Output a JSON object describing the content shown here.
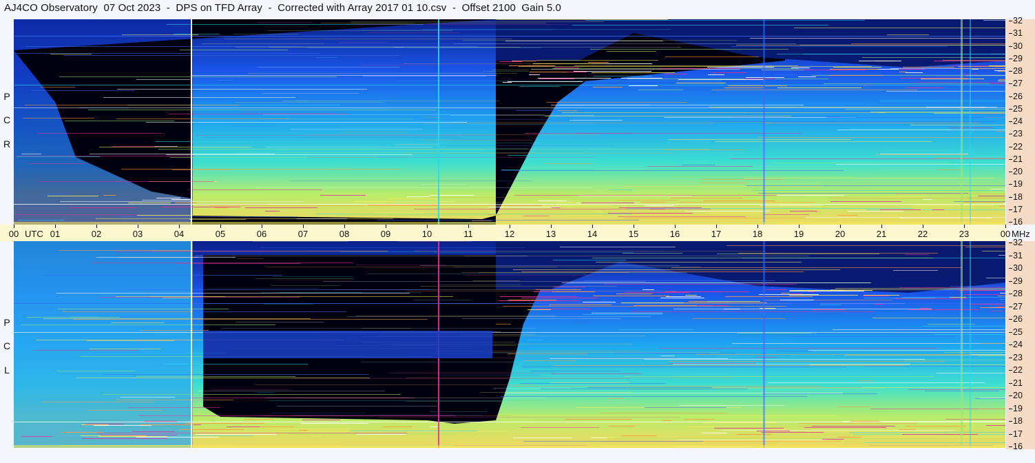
{
  "header": {
    "title": "AJ4CO Observatory  07 Oct 2023  -  DPS on TFD Array  -  Corrected with Array 2017 01 10.csv  -  Offset 2100  Gain 5.0"
  },
  "chart_data": [
    {
      "type": "heatmap",
      "panel": "top",
      "polarization_label": [
        "R",
        "C",
        "P"
      ],
      "x_ticks": [
        "00",
        "01",
        "02",
        "03",
        "04",
        "05",
        "06",
        "07",
        "08",
        "09",
        "10",
        "11",
        "12",
        "13",
        "14",
        "15",
        "16",
        "17",
        "18",
        "19",
        "20",
        "21",
        "22",
        "23",
        "00"
      ],
      "x_label": "UTC",
      "y_ticks": [
        "16",
        "17",
        "18",
        "19",
        "20",
        "21",
        "22",
        "23",
        "24",
        "25",
        "26",
        "27",
        "28",
        "29",
        "30",
        "31",
        "32"
      ],
      "y_label": "MHz",
      "ylim": [
        16,
        32
      ],
      "xlim": [
        0,
        24
      ]
    },
    {
      "type": "heatmap",
      "panel": "bottom",
      "polarization_label": [
        "L",
        "C",
        "P"
      ],
      "x_ticks": [
        "00",
        "01",
        "02",
        "03",
        "04",
        "05",
        "06",
        "07",
        "08",
        "09",
        "10",
        "11",
        "12",
        "13",
        "14",
        "15",
        "16",
        "17",
        "18",
        "19",
        "20",
        "21",
        "22",
        "23",
        "00"
      ],
      "x_label": "UTC",
      "y_ticks": [
        "16",
        "17",
        "18",
        "19",
        "20",
        "21",
        "22",
        "23",
        "24",
        "25",
        "26",
        "27",
        "28",
        "29",
        "30",
        "31",
        "32"
      ],
      "y_label": "MHz",
      "ylim": [
        16,
        32
      ],
      "xlim": [
        0,
        24
      ]
    }
  ],
  "colors": {
    "dark": "#000018",
    "blue": "#1a4fe0",
    "cyan": "#2ad6f0",
    "green": "#9be870",
    "yellow": "#f5e85a",
    "magenta": "#e0339a",
    "axis_bg_time": "#fdf8cf",
    "axis_bg_freq": "#f6dcc6"
  }
}
